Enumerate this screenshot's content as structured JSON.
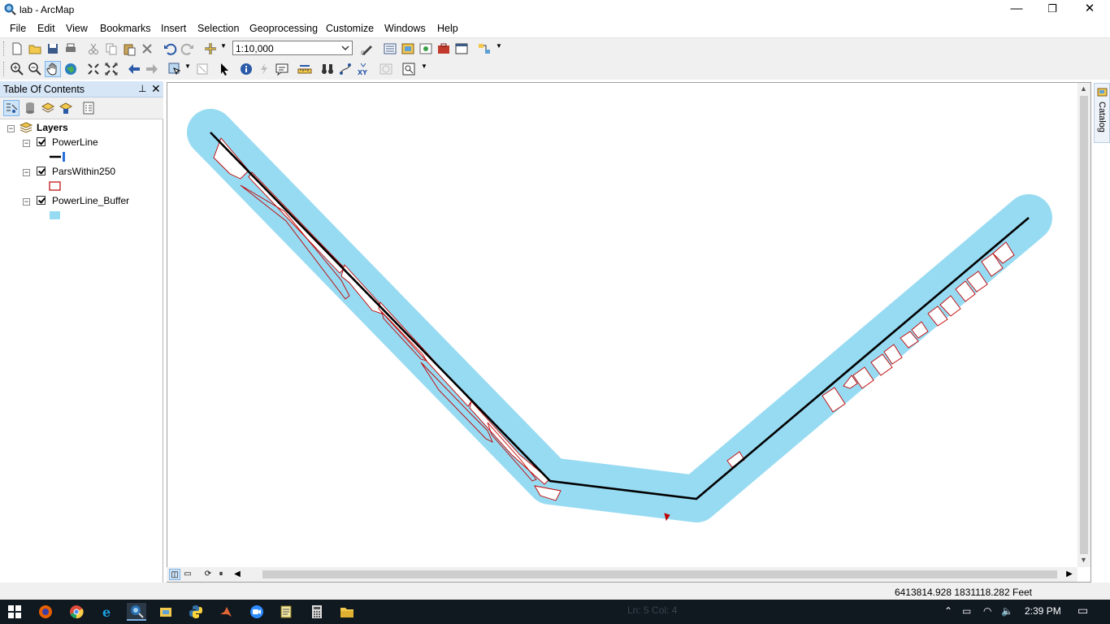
{
  "window": {
    "title": "lab - ArcMap",
    "controls": {
      "minimize": "—",
      "restore": "❐",
      "close": "✕"
    }
  },
  "menubar": {
    "items": [
      "File",
      "Edit",
      "View",
      "Bookmarks",
      "Insert",
      "Selection",
      "Geoprocessing",
      "Customize",
      "Windows",
      "Help"
    ]
  },
  "toolbar": {
    "scale_value": "1:10,000"
  },
  "toc": {
    "title": "Table Of Contents",
    "pin": "⊥",
    "close": "✕",
    "root_label": "Layers",
    "layers": [
      {
        "name": "PowerLine",
        "checked": true,
        "symbol": "line",
        "color": "#000000"
      },
      {
        "name": "ParsWithin250",
        "checked": true,
        "symbol": "polygon-outline",
        "color": "#c00000"
      },
      {
        "name": "PowerLine_Buffer",
        "checked": true,
        "symbol": "polygon-fill",
        "color": "#97dbf2"
      }
    ]
  },
  "catalog_tab": {
    "label": "Catalog"
  },
  "statusbar": {
    "coordinates": "6413814.928  1831118.282 Feet"
  },
  "taskbar": {
    "ghost_text": "Ln: 5 Col: 4",
    "time": "2:39 PM"
  },
  "colors": {
    "buffer": "#97dbf2",
    "parcel_outline": "#c00000",
    "powerline": "#000000"
  }
}
